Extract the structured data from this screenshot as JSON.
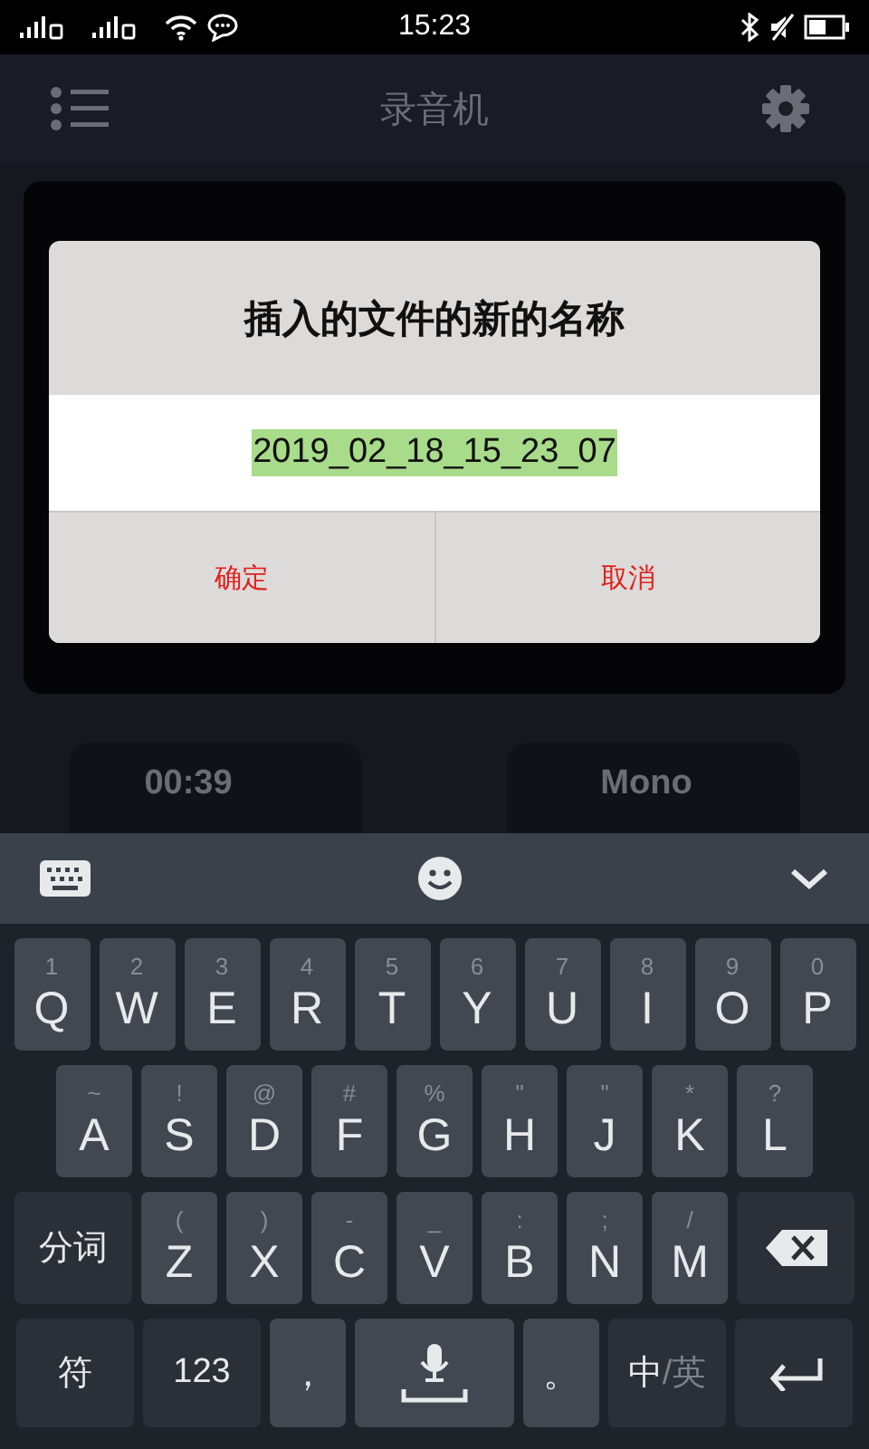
{
  "status_bar": {
    "time": "15:23"
  },
  "app_bar": {
    "title": "录音机"
  },
  "dialog": {
    "title": "插入的文件的新的名称",
    "value": "2019_02_18_15_23_07",
    "value_selected": true,
    "buttons": [
      "确定",
      "取消"
    ]
  },
  "cards": [
    {
      "value": "00:39"
    },
    {
      "value": "Mono"
    }
  ],
  "keyboard": {
    "rows": [
      {
        "keys": [
          {
            "kind": "letter",
            "label": "Q",
            "hint": "1"
          },
          {
            "kind": "letter",
            "label": "W",
            "hint": "2"
          },
          {
            "kind": "letter",
            "label": "E",
            "hint": "3"
          },
          {
            "kind": "letter",
            "label": "R",
            "hint": "4"
          },
          {
            "kind": "letter",
            "label": "T",
            "hint": "5"
          },
          {
            "kind": "letter",
            "label": "Y",
            "hint": "6"
          },
          {
            "kind": "letter",
            "label": "U",
            "hint": "7"
          },
          {
            "kind": "letter",
            "label": "I",
            "hint": "8"
          },
          {
            "kind": "letter",
            "label": "O",
            "hint": "9"
          },
          {
            "kind": "letter",
            "label": "P",
            "hint": "0"
          }
        ]
      },
      {
        "keys": [
          {
            "kind": "letter",
            "label": "A",
            "hint": "~"
          },
          {
            "kind": "letter",
            "label": "S",
            "hint": "!"
          },
          {
            "kind": "letter",
            "label": "D",
            "hint": "@"
          },
          {
            "kind": "letter",
            "label": "F",
            "hint": "#"
          },
          {
            "kind": "letter",
            "label": "G",
            "hint": "%"
          },
          {
            "kind": "letter",
            "label": "H",
            "hint": "\""
          },
          {
            "kind": "letter",
            "label": "J",
            "hint": "\""
          },
          {
            "kind": "letter",
            "label": "K",
            "hint": "*"
          },
          {
            "kind": "letter",
            "label": "L",
            "hint": "?"
          }
        ]
      },
      {
        "keys": [
          {
            "kind": "text",
            "label": "分词"
          },
          {
            "kind": "letter",
            "label": "Z",
            "hint": "("
          },
          {
            "kind": "letter",
            "label": "X",
            "hint": ")"
          },
          {
            "kind": "letter",
            "label": "C",
            "hint": "-"
          },
          {
            "kind": "letter",
            "label": "V",
            "hint": "_"
          },
          {
            "kind": "letter",
            "label": "B",
            "hint": ":"
          },
          {
            "kind": "letter",
            "label": "N",
            "hint": ";"
          },
          {
            "kind": "letter",
            "label": "M",
            "hint": "/"
          },
          {
            "kind": "backspace"
          }
        ]
      },
      {
        "keys": [
          {
            "kind": "text",
            "label": "符"
          },
          {
            "kind": "text",
            "label": "123"
          },
          {
            "kind": "punct",
            "label": "，"
          },
          {
            "kind": "mic"
          },
          {
            "kind": "punct",
            "label": "。"
          },
          {
            "kind": "lang",
            "label": "中",
            "secondary": "/英"
          },
          {
            "kind": "enter"
          }
        ]
      }
    ]
  }
}
